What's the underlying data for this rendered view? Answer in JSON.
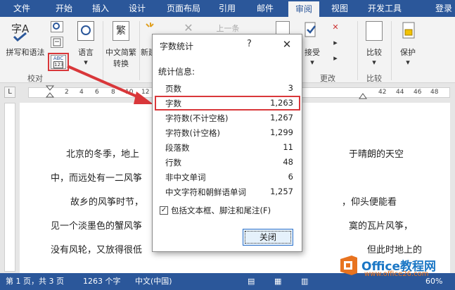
{
  "ribbon_tabs": [
    "文件",
    "开始",
    "插入",
    "设计",
    "页面布局",
    "引用",
    "邮件",
    "审阅",
    "视图",
    "开发工具"
  ],
  "active_tab": "审阅",
  "login_label": "登录",
  "ribbon": {
    "spell_label": "拼写和语法",
    "spell_icon_text": "字A",
    "abc_icon_top": "ABC",
    "abc_icon_bottom": "123",
    "language_label": "语言",
    "convert_label_1": "中文简繁",
    "convert_label_2": "转换",
    "convert_icon_text": "繁",
    "new_label": "新建",
    "next_label": "上一条",
    "accept_label": "接受",
    "compare_label": "比较",
    "protect_label": "保护",
    "group_proofing": "校对",
    "group_changes": "更改",
    "group_compare": "比较"
  },
  "ruler_numbers": [
    "2",
    "4",
    "6",
    "8",
    "10",
    "12",
    "42",
    "44",
    "46",
    "48"
  ],
  "ruler_corner": "L",
  "document": {
    "lines": [
      "北京的冬季，地上",
      "于晴朗的天空",
      "中，而远处有一二风筝",
      "故乡的风筝时节，",
      "，仰头便能看",
      "见一个淡墨色的蟹风筝",
      "寞的瓦片风筝，",
      "没有风轮，又放得很低",
      "但此时地上的"
    ]
  },
  "statusbar": {
    "page": "第 1 页，共 3 页",
    "words": "1263 个字",
    "language": "中文(中国)",
    "zoom": "60%"
  },
  "watermark": {
    "brand": "Office教程网",
    "url": "www.office26.com"
  },
  "dialog": {
    "title": "字数统计",
    "help": "?",
    "close": "✕",
    "info_label": "统计信息:",
    "stats": [
      {
        "label": "页数",
        "value": "3"
      },
      {
        "label": "字数",
        "value": "1,263"
      },
      {
        "label": "字符数(不计空格)",
        "value": "1,267"
      },
      {
        "label": "字符数(计空格)",
        "value": "1,299"
      },
      {
        "label": "段落数",
        "value": "11"
      },
      {
        "label": "行数",
        "value": "48"
      },
      {
        "label": "非中文单词",
        "value": "6"
      },
      {
        "label": "中文字符和朝鲜语单词",
        "value": "1,257"
      }
    ],
    "checkbox_checked": true,
    "checkbox_label": "包括文本框、脚注和尾注(F)",
    "close_button": "关闭"
  },
  "colors": {
    "ribbon_blue": "#2b579a",
    "highlight_red": "#d9373a",
    "watermark_blue": "#1b77c5",
    "watermark_orange": "#e8731f"
  }
}
